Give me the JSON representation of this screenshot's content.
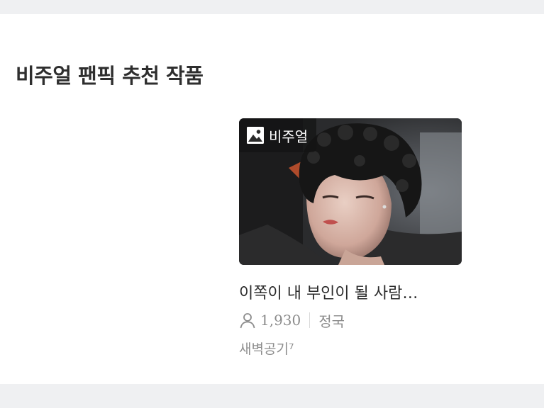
{
  "section": {
    "title": "비주얼 팬픽 추천 작품"
  },
  "item": {
    "badge": {
      "label": "비주얼",
      "icon": "image-icon"
    },
    "title": "이쪽이 내 부인이 될 사람…",
    "views": "1,930",
    "tag": "정국",
    "author": "새벽공기⁷",
    "thumbnail": {
      "description_icon": "thumbnail-image"
    }
  },
  "colors": {
    "background": "#eff0f2",
    "card": "#ffffff",
    "title_text": "#2e2e2e",
    "meta_text": "#8c8c8c"
  }
}
